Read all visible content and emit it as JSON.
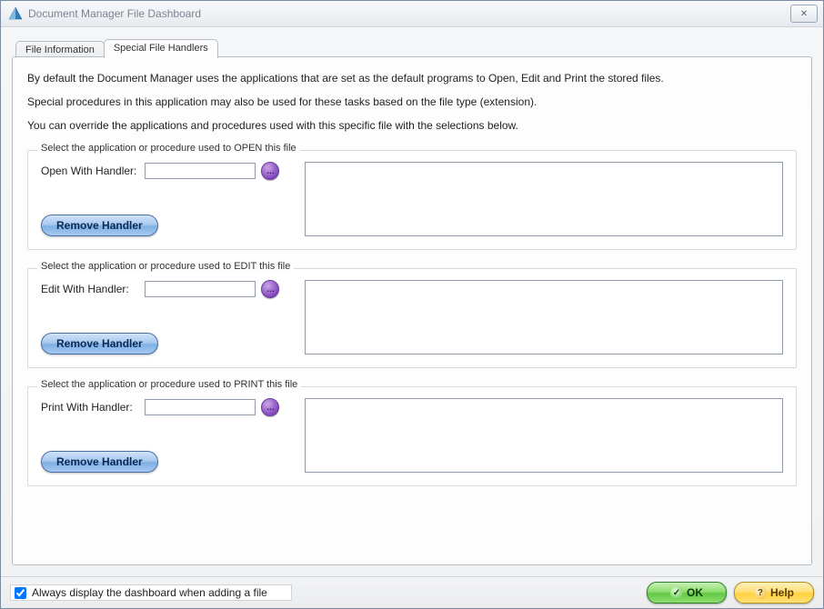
{
  "window": {
    "title": "Document Manager File Dashboard",
    "close_symbol": "✕"
  },
  "tabs": {
    "file_info": "File Information",
    "special": "Special File Handlers"
  },
  "intro": {
    "p1": "By default the Document Manager uses the applications that are set as the default programs to Open, Edit and Print the stored files.",
    "p2": "Special procedures in this application may also be used for these tasks based on the file type (extension).",
    "p3": "You can override the applications and procedures used with this specific file with the selections below."
  },
  "groups": {
    "open": {
      "legend": "Select the application or procedure used to OPEN this file",
      "label": "Open With Handler:",
      "value": "",
      "desc": "",
      "remove": "Remove Handler"
    },
    "edit": {
      "legend": "Select the application or procedure used to EDIT this file",
      "label": "Edit With Handler:",
      "value": "",
      "desc": "",
      "remove": "Remove Handler"
    },
    "print": {
      "legend": "Select the application or procedure used to PRINT this file",
      "label": "Print With Handler:",
      "value": "",
      "desc": "",
      "remove": "Remove Handler"
    }
  },
  "ui": {
    "browse_dots": "…"
  },
  "footer": {
    "checkbox_label": "Always display the dashboard when adding a file",
    "checkbox_checked": true,
    "ok": "OK",
    "help": "Help",
    "ok_glyph": "✓",
    "help_glyph": "?"
  }
}
